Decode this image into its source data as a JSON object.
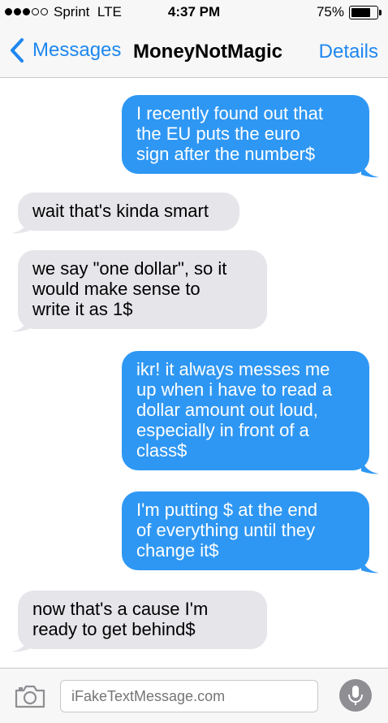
{
  "status_bar": {
    "carrier": "Sprint",
    "network": "LTE",
    "time": "4:37 PM",
    "battery": "75%",
    "battery_level": 0.75,
    "signal_strength": 3
  },
  "nav": {
    "back_label": "Messages",
    "title": "MoneyNotMagic",
    "details_label": "Details"
  },
  "messages": [
    {
      "from": "me",
      "lines": [
        "I recently found out that",
        "the EU puts the euro",
        "sign after the number$"
      ]
    },
    {
      "from": "them",
      "lines": [
        "wait that's kinda smart"
      ]
    },
    {
      "from": "them",
      "lines": [
        "we say \"one dollar\", so it",
        "would make sense to",
        "write it as 1$"
      ]
    },
    {
      "from": "me",
      "lines": [
        "ikr! it always messes me",
        "up when i have to read a",
        "dollar amount out loud,",
        "especially in front of a",
        "class$"
      ]
    },
    {
      "from": "me",
      "lines": [
        "I'm putting $ at the end",
        "of everything until they",
        "change it$"
      ]
    },
    {
      "from": "them",
      "lines": [
        "now that's a cause I'm",
        "ready to get behind$"
      ]
    }
  ],
  "input": {
    "placeholder": "iFakeTextMessage.com"
  },
  "icons": {
    "back": "chevron-left-icon",
    "camera": "camera-icon",
    "mic": "microphone-icon"
  },
  "colors": {
    "accent": "#1e87f0",
    "sent_bubble": "#2e97f3",
    "received_bubble": "#e5e5ea"
  }
}
